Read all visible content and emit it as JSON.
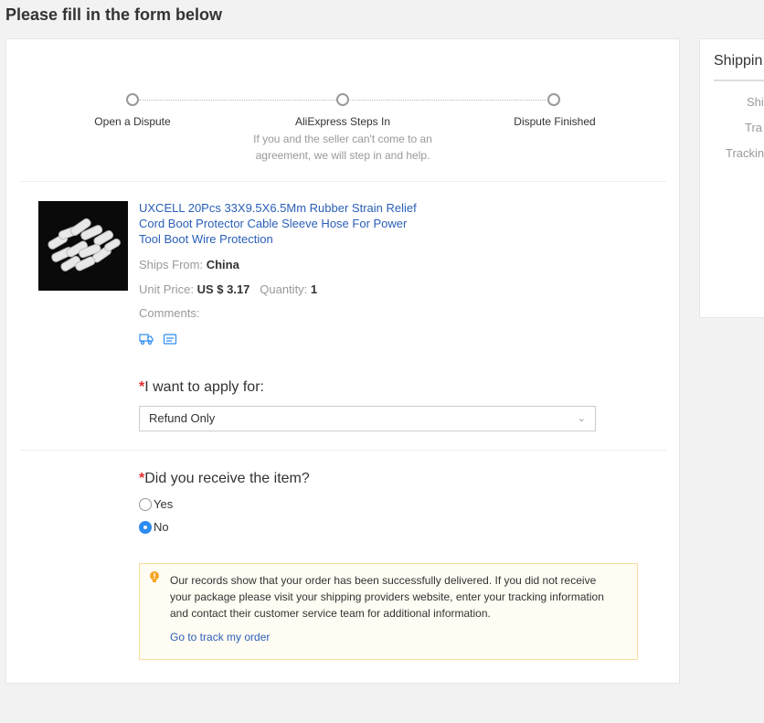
{
  "page": {
    "title": "Please fill in the form below"
  },
  "steps": [
    {
      "label": "Open a Dispute"
    },
    {
      "label": "AliExpress Steps In",
      "description": "If you and the seller can't come to an agreement, we will step in and help."
    },
    {
      "label": "Dispute Finished"
    }
  ],
  "product": {
    "title": "UXCELL 20Pcs 33X9.5X6.5Mm Rubber Strain Relief Cord Boot Protector Cable Sleeve Hose For Power Tool Boot Wire Protection",
    "ships_from_label": "Ships From:",
    "ships_from": "China",
    "unit_price_label": "Unit Price:",
    "unit_price": "US $ 3.17",
    "quantity_label": "Quantity:",
    "quantity": "1",
    "comments_label": "Comments:",
    "icons": [
      "shipping-truck-icon",
      "message-card-icon"
    ]
  },
  "apply": {
    "required_mark": "*",
    "question": "I want to apply for:",
    "selected": "Refund Only"
  },
  "received": {
    "required_mark": "*",
    "question": "Did you receive the item?",
    "options": [
      {
        "label": "Yes",
        "checked": false
      },
      {
        "label": "No",
        "checked": true
      }
    ]
  },
  "notice": {
    "icon": "lightbulb-icon",
    "text": "Our records show that your order has been successfully delivered. If you did not receive your package please visit your shipping providers website, enter your tracking information and contact their customer service team for additional information.",
    "link": "Go to track my order"
  },
  "sidebar": {
    "title": "Shippin",
    "items": [
      "Shi",
      "Tra",
      "Trackin"
    ]
  },
  "colors": {
    "link": "#2a5fb8",
    "required": "#e62e2e",
    "radio_checked": "#2c8cf0",
    "notice_border": "#f8dba0"
  }
}
